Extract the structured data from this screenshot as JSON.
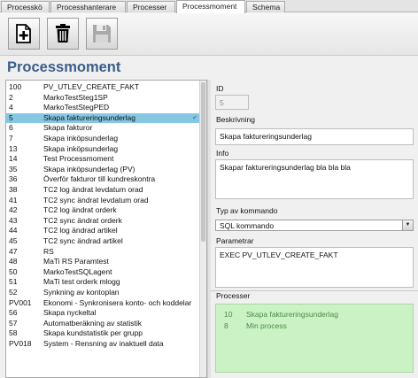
{
  "tabs": [
    {
      "label": "Processkö",
      "active": false
    },
    {
      "label": "Processhanterare",
      "active": false
    },
    {
      "label": "Processer",
      "active": false
    },
    {
      "label": "Processmoment",
      "active": true
    },
    {
      "label": "Schema",
      "active": false
    }
  ],
  "toolbar": {
    "buttons": [
      {
        "icon": "add-document-icon",
        "enabled": true
      },
      {
        "icon": "trash-icon",
        "enabled": true
      },
      {
        "icon": "save-icon",
        "enabled": false
      }
    ]
  },
  "page_title": "Processmoment",
  "list": {
    "selected_index": 3,
    "items": [
      {
        "id": "100",
        "name": "PV_UTLEV_CREATE_FAKT"
      },
      {
        "id": "2",
        "name": "MarkoTestSteg1SP"
      },
      {
        "id": "4",
        "name": "MarkoTestStegPED"
      },
      {
        "id": "5",
        "name": "Skapa faktureringsunderlag"
      },
      {
        "id": "6",
        "name": "Skapa fakturor"
      },
      {
        "id": "7",
        "name": "Skapa inköpsunderlag"
      },
      {
        "id": "13",
        "name": "Skapa inköpsunderlag"
      },
      {
        "id": "14",
        "name": "Test Processmoment"
      },
      {
        "id": "35",
        "name": "Skapa inköpsunderlag (PV)"
      },
      {
        "id": "36",
        "name": "Överför fakturor till kundreskontra"
      },
      {
        "id": "38",
        "name": "TC2 log ändrat levdatum orad"
      },
      {
        "id": "41",
        "name": "TC2 sync ändrat levdatum orad"
      },
      {
        "id": "42",
        "name": "TC2 log ändrat orderk"
      },
      {
        "id": "43",
        "name": "TC2 sync ändrat orderk"
      },
      {
        "id": "44",
        "name": "TC2 log ändrad artikel"
      },
      {
        "id": "45",
        "name": "TC2 sync ändrad artikel"
      },
      {
        "id": "47",
        "name": "RS"
      },
      {
        "id": "48",
        "name": "MaTi RS Paramtest"
      },
      {
        "id": "50",
        "name": "MarkoTestSQLagent"
      },
      {
        "id": "51",
        "name": "MaTi test orderk mlogg"
      },
      {
        "id": "52",
        "name": "Synkning av kontoplan"
      },
      {
        "id": "PV001",
        "name": "Ekonomi - Synkronisera konto- och koddelar"
      },
      {
        "id": "56",
        "name": "Skapa nyckeltal"
      },
      {
        "id": "57",
        "name": "Automatberäkning av statistik"
      },
      {
        "id": "58",
        "name": "Skapa kundstatistik per grupp"
      },
      {
        "id": "PV018",
        "name": "System - Rensning av inaktuell data"
      }
    ]
  },
  "form": {
    "id_label": "ID",
    "id_value": "5",
    "description_label": "Beskrivning",
    "description_value": "Skapa faktureringsunderlag",
    "info_label": "Info",
    "info_value": "Skapar faktureringsunderlag bla bla bla",
    "command_type_label": "Typ av kommando",
    "command_type_value": "SQL kommando",
    "params_label": "Parametrar",
    "params_value": "EXEC PV_UTLEV_CREATE_FAKT"
  },
  "processes": {
    "title": "Processer",
    "items": [
      {
        "id": "10",
        "name": "Skapa faktureringsunderlag"
      },
      {
        "id": "8",
        "name": "Min process"
      }
    ]
  },
  "colors": {
    "title": "#3b5d8a",
    "selection": "#86c8e4",
    "processes_bg": "#cbf2c5",
    "processes_text": "#4d8a48"
  }
}
